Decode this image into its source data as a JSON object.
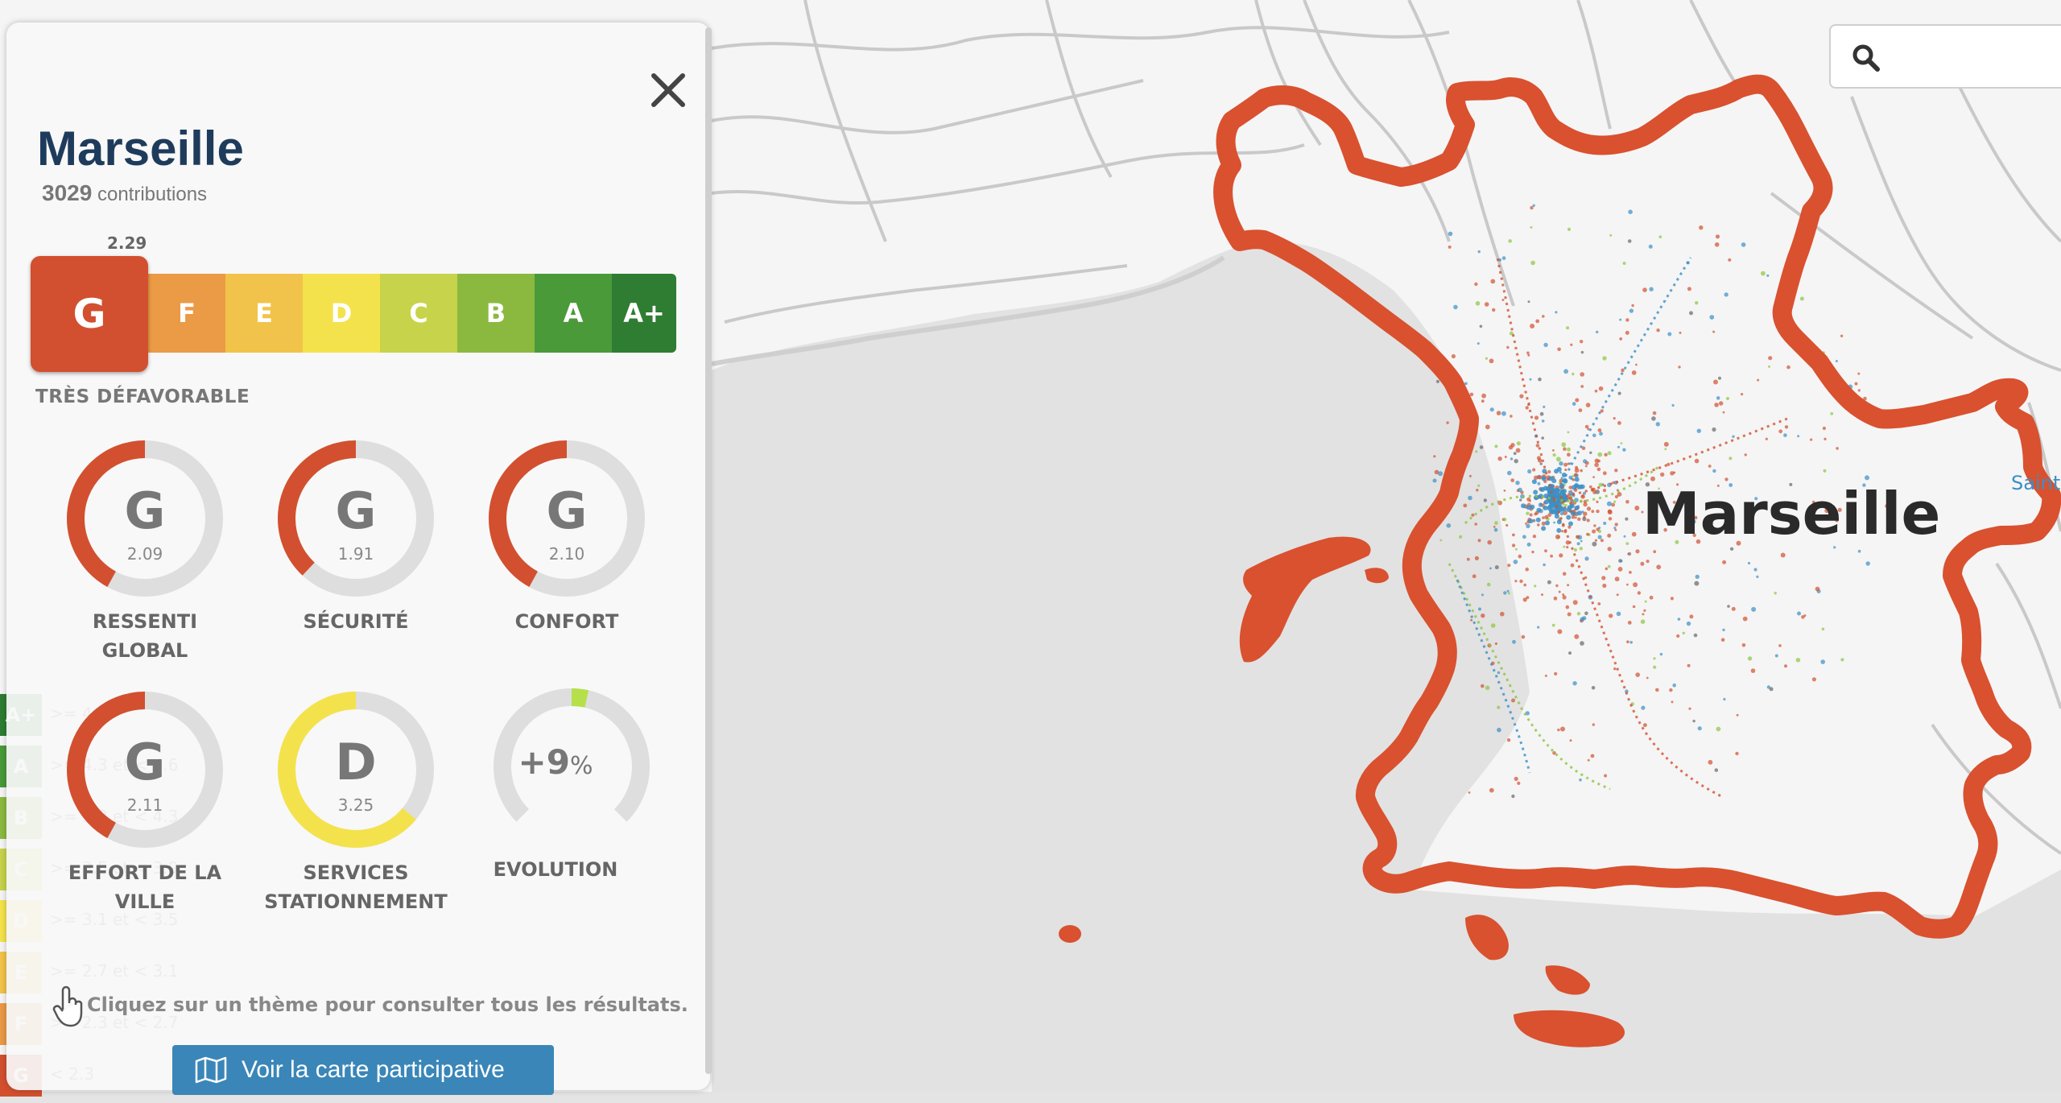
{
  "map": {
    "city_label": "Marseille",
    "side_label": "Saint",
    "boundary_color": "#d9512f",
    "sea_color": "#e0e0e0",
    "land_color": "#f5f5f5",
    "dot_colors": [
      "#d2502f",
      "#3b8fc6",
      "#8cc63f",
      "#666666"
    ]
  },
  "search": {
    "icon": "search-icon"
  },
  "legend": [
    {
      "grade": "A+",
      "range": ">= 4.6",
      "color": "#2e7d32"
    },
    {
      "grade": "A",
      "range": ">= 4.3 et < 4.6",
      "color": "#4a9a3a"
    },
    {
      "grade": "B",
      "range": ">= 3.9 et < 4.3",
      "color": "#8bb940"
    },
    {
      "grade": "C",
      "range": ">= 3.5 et < 3.9",
      "color": "#c7d34a"
    },
    {
      "grade": "D",
      "range": ">= 3.1 et < 3.5",
      "color": "#f4e24c"
    },
    {
      "grade": "E",
      "range": ">= 2.7 et < 3.1",
      "color": "#f2c34a"
    },
    {
      "grade": "F",
      "range": ">= 2.3 et < 2.7",
      "color": "#eb9a45"
    },
    {
      "grade": "G",
      "range": "< 2.3",
      "color": "#d2502f"
    }
  ],
  "panel": {
    "city": "Marseille",
    "contributions_count": "3029",
    "contributions_label": "contributions",
    "score": "2.29",
    "current_grade": "G",
    "verdict": "TRÈS DÉFAVORABLE",
    "scale": [
      {
        "grade": "F",
        "color": "#eb9a45"
      },
      {
        "grade": "E",
        "color": "#f2c34a"
      },
      {
        "grade": "D",
        "color": "#f4e24c"
      },
      {
        "grade": "C",
        "color": "#c7d34a"
      },
      {
        "grade": "B",
        "color": "#8bb940"
      },
      {
        "grade": "A",
        "color": "#4a9a3a"
      },
      {
        "grade": "A+",
        "color": "#2e7d32"
      }
    ],
    "themes": [
      {
        "grade": "G",
        "score": "2.09",
        "label_1": "RESSENTI",
        "label_2": "GLOBAL",
        "fraction": 0.42,
        "color": "#d2502f"
      },
      {
        "grade": "G",
        "score": "1.91",
        "label_1": "SÉCURITÉ",
        "label_2": "",
        "fraction": 0.38,
        "color": "#d2502f"
      },
      {
        "grade": "G",
        "score": "2.10",
        "label_1": "CONFORT",
        "label_2": "",
        "fraction": 0.42,
        "color": "#d2502f"
      },
      {
        "grade": "G",
        "score": "2.11",
        "label_1": "EFFORT DE LA",
        "label_2": "VILLE",
        "fraction": 0.42,
        "color": "#d2502f"
      },
      {
        "grade": "D",
        "score": "3.25",
        "label_1": "SERVICES",
        "label_2": "STATIONNEMENT",
        "fraction": 0.64,
        "color": "#f4e24c"
      }
    ],
    "evolution": {
      "value": "+9",
      "unit": "%",
      "label": "EVOLUTION",
      "color": "#b5e04a",
      "fraction": 0.035
    },
    "hint": "Cliquez sur un thème pour consulter tous les résultats.",
    "cta_label": "Voir la carte participative"
  }
}
